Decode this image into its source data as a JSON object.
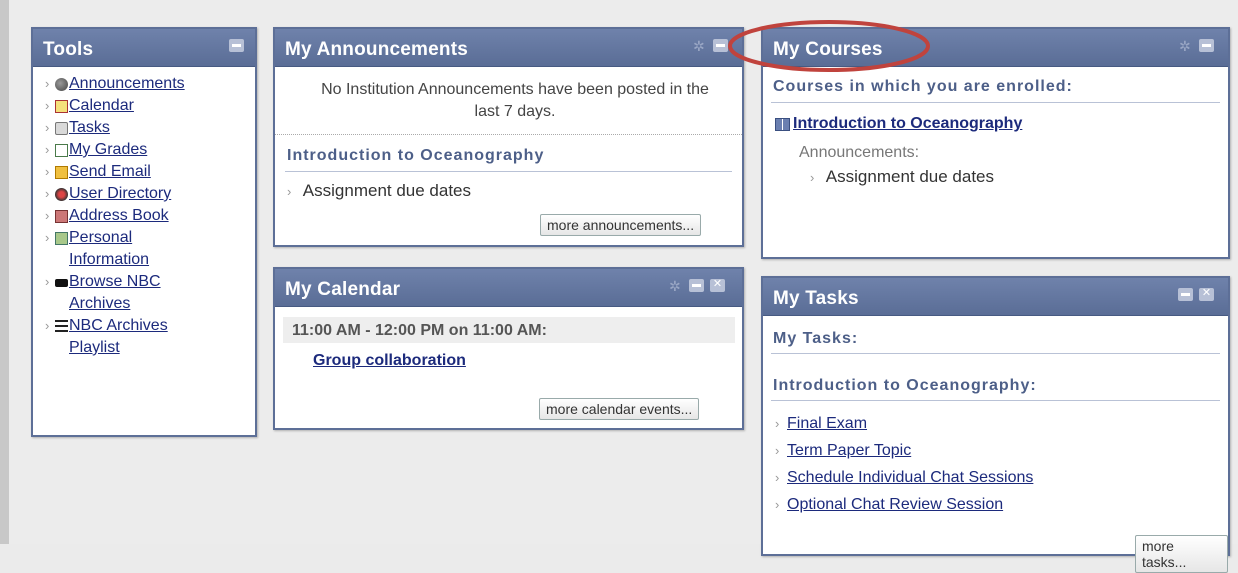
{
  "tools": {
    "title": "Tools",
    "items": [
      {
        "label": "Announcements",
        "icon": "announcements-icon"
      },
      {
        "label": "Calendar",
        "icon": "calendar-icon"
      },
      {
        "label": "Tasks",
        "icon": "tasks-icon"
      },
      {
        "label": "My Grades",
        "icon": "grades-icon"
      },
      {
        "label": "Send Email",
        "icon": "email-icon"
      },
      {
        "label": "User Directory",
        "icon": "user-directory-icon"
      },
      {
        "label": "Address Book",
        "icon": "address-book-icon"
      },
      {
        "label": "Personal\nInformation",
        "icon": "personal-info-icon"
      },
      {
        "label": "Browse NBC\nArchives",
        "icon": "nbc-archives-icon"
      },
      {
        "label": "NBC Archives\nPlaylist",
        "icon": "playlist-icon"
      }
    ]
  },
  "announcements": {
    "title": "My Announcements",
    "notice": "No Institution Announcements have been posted in the last 7 days.",
    "course": "Introduction to Oceanography",
    "item": "Assignment due dates",
    "more": "more announcements..."
  },
  "calendar": {
    "title": "My Calendar",
    "time": "11:00 AM - 12:00 PM on 11:00 AM:",
    "event": "Group collaboration",
    "more": "more calendar events..."
  },
  "courses": {
    "title": "My Courses",
    "subtitle": "Courses in which you are enrolled:",
    "course": "Introduction to Oceanography",
    "ann_label": "Announcements:",
    "ann_item": "Assignment due dates"
  },
  "tasks": {
    "title": "My Tasks",
    "my_tasks": "My Tasks:",
    "course": "Introduction to Oceanography:",
    "items": [
      "Final Exam",
      "Term Paper Topic",
      "Schedule Individual Chat Sessions",
      "Optional Chat Review Session"
    ],
    "more": "more tasks..."
  },
  "colors": {
    "header": "#5d6f97",
    "link": "#1c2a7c",
    "highlight_circle": "#c0433d"
  }
}
